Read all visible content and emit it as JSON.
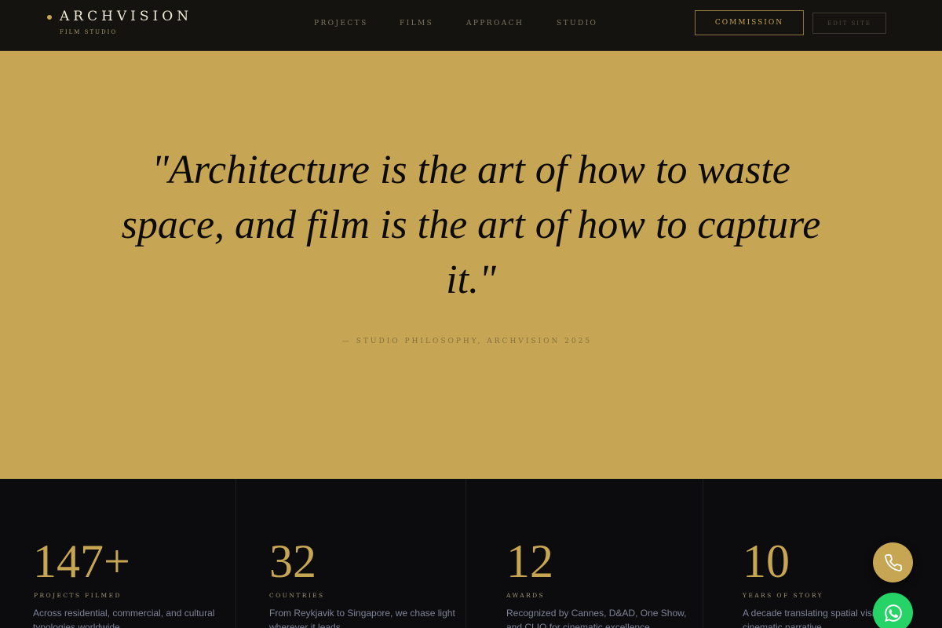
{
  "header": {
    "brand_name": "ARCHVISION",
    "brand_sub": "FILM STUDIO",
    "nav": [
      "PROJECTS",
      "FILMS",
      "APPROACH",
      "STUDIO"
    ],
    "commission_label": "COMMISSION",
    "edit_label": "EDIT SITE"
  },
  "hero": {
    "quote": "\"Architecture is the art of how to waste space, and film is the art of how to capture it.\"",
    "attribution": "— STUDIO PHILOSOPHY, ARCHVISION 2025"
  },
  "stats": [
    {
      "number": "147+",
      "label": "PROJECTS FILMED",
      "desc": "Across residential, commercial, and cultural typologies worldwide."
    },
    {
      "number": "32",
      "label": "COUNTRIES",
      "desc": "From Reykjavik to Singapore, we chase light wherever it leads."
    },
    {
      "number": "12",
      "label": "AWARDS",
      "desc": "Recognized by Cannes, D&AD, One Show, and CLIO for cinematic excellence."
    },
    {
      "number": "10",
      "label": "YEARS OF STORY",
      "desc": "A decade translating spatial vision into cinematic narrative."
    }
  ],
  "icons": {
    "phone": "phone-icon",
    "whatsapp": "whatsapp-icon"
  },
  "colors": {
    "accent_gold": "#c6a553",
    "hero_bg": "#c6a654",
    "dark_bg": "#0c0c0e",
    "whatsapp_green": "#25d366"
  }
}
